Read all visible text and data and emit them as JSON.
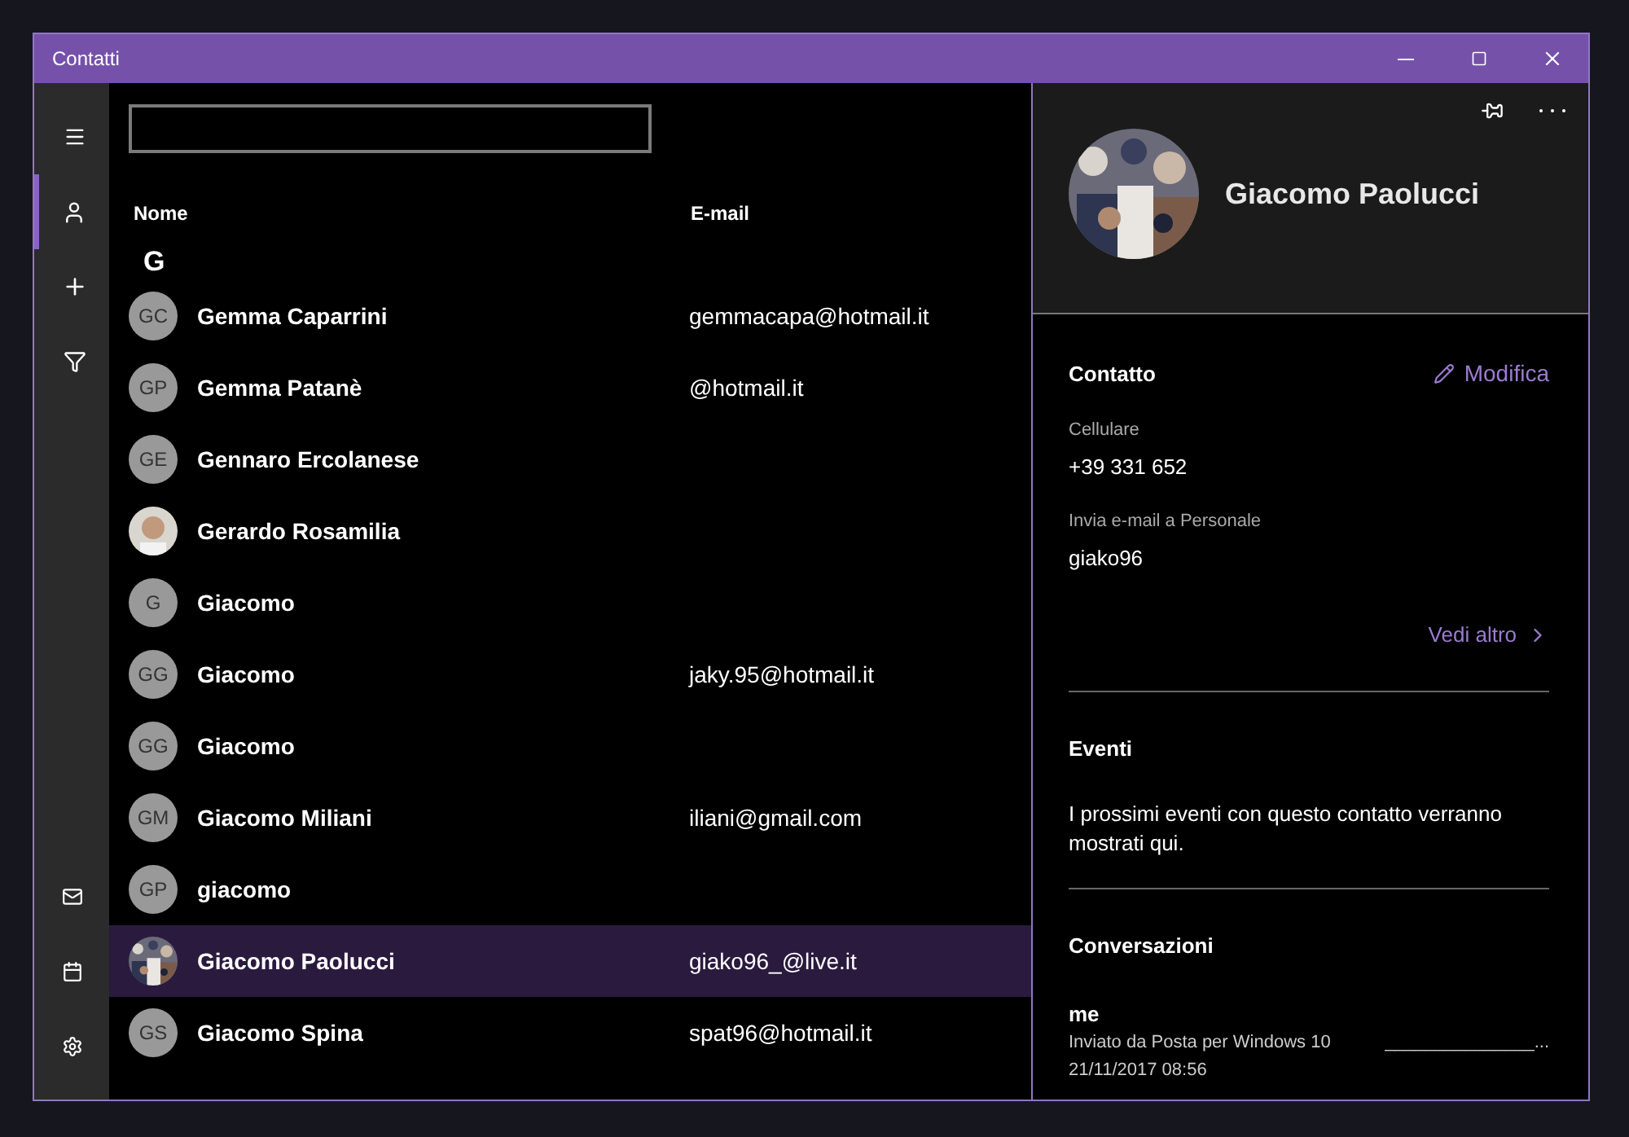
{
  "window": {
    "title": "Contatti"
  },
  "sidebar": {
    "items": [
      {
        "kind": "menu",
        "selected": false
      },
      {
        "kind": "people",
        "selected": true
      },
      {
        "kind": "add",
        "selected": false
      },
      {
        "kind": "filter",
        "selected": false
      }
    ],
    "bottom_items": [
      {
        "kind": "mail"
      },
      {
        "kind": "calendar"
      },
      {
        "kind": "settings"
      }
    ]
  },
  "list": {
    "columns": [
      "Nome",
      "E-mail"
    ],
    "group": "G",
    "rows": [
      {
        "initials": "GC",
        "name": "Gemma Caparrini",
        "email": "gemmacapa@hotmail.it",
        "selected": false
      },
      {
        "initials": "GP",
        "name": "Gemma Patanè",
        "email": "@hotmail.it",
        "selected": false
      },
      {
        "initials": "GE",
        "name": "Gennaro Ercolanese",
        "selected": false
      },
      {
        "kind": "picture",
        "name": "Gerardo Rosamilia",
        "selected": false
      },
      {
        "initials": "G",
        "name": "Giacomo",
        "selected": false
      },
      {
        "initials": "GG",
        "name": "Giacomo",
        "email": "jaky.95@hotmail.it",
        "selected": false
      },
      {
        "initials": "GG",
        "name": "Giacomo",
        "selected": false
      },
      {
        "initials": "GM",
        "name": "Giacomo Miliani",
        "email": "iliani@gmail.com",
        "selected": false
      },
      {
        "initials": "GP",
        "name": "giacomo",
        "selected": false
      },
      {
        "kind": "picture",
        "name": "Giacomo Paolucci",
        "email": "giako96_@live.it",
        "selected": true
      },
      {
        "initials": "GS",
        "name": "Giacomo Spina",
        "email": "spat96@hotmail.it",
        "selected": false
      }
    ]
  },
  "details": {
    "name": "Giacomo Paolucci",
    "contact": {
      "title": "Contatto",
      "edit": "Modifica",
      "fields": [
        {
          "label": "Cellulare",
          "value": "+39 331 652"
        },
        {
          "label": "Invia e-mail a Personale",
          "value": "giako96"
        }
      ],
      "more": "Vedi altro"
    },
    "events": {
      "title": "Eventi",
      "text": "I prossimi eventi con questo contatto verranno mostrati qui."
    },
    "conversations": {
      "title": "Conversazioni",
      "items": [
        {
          "from": "me",
          "subject": "Inviato da Posta per Windows 10",
          "preview": "_______________...",
          "date": "21/11/2017 08:56"
        }
      ]
    }
  }
}
